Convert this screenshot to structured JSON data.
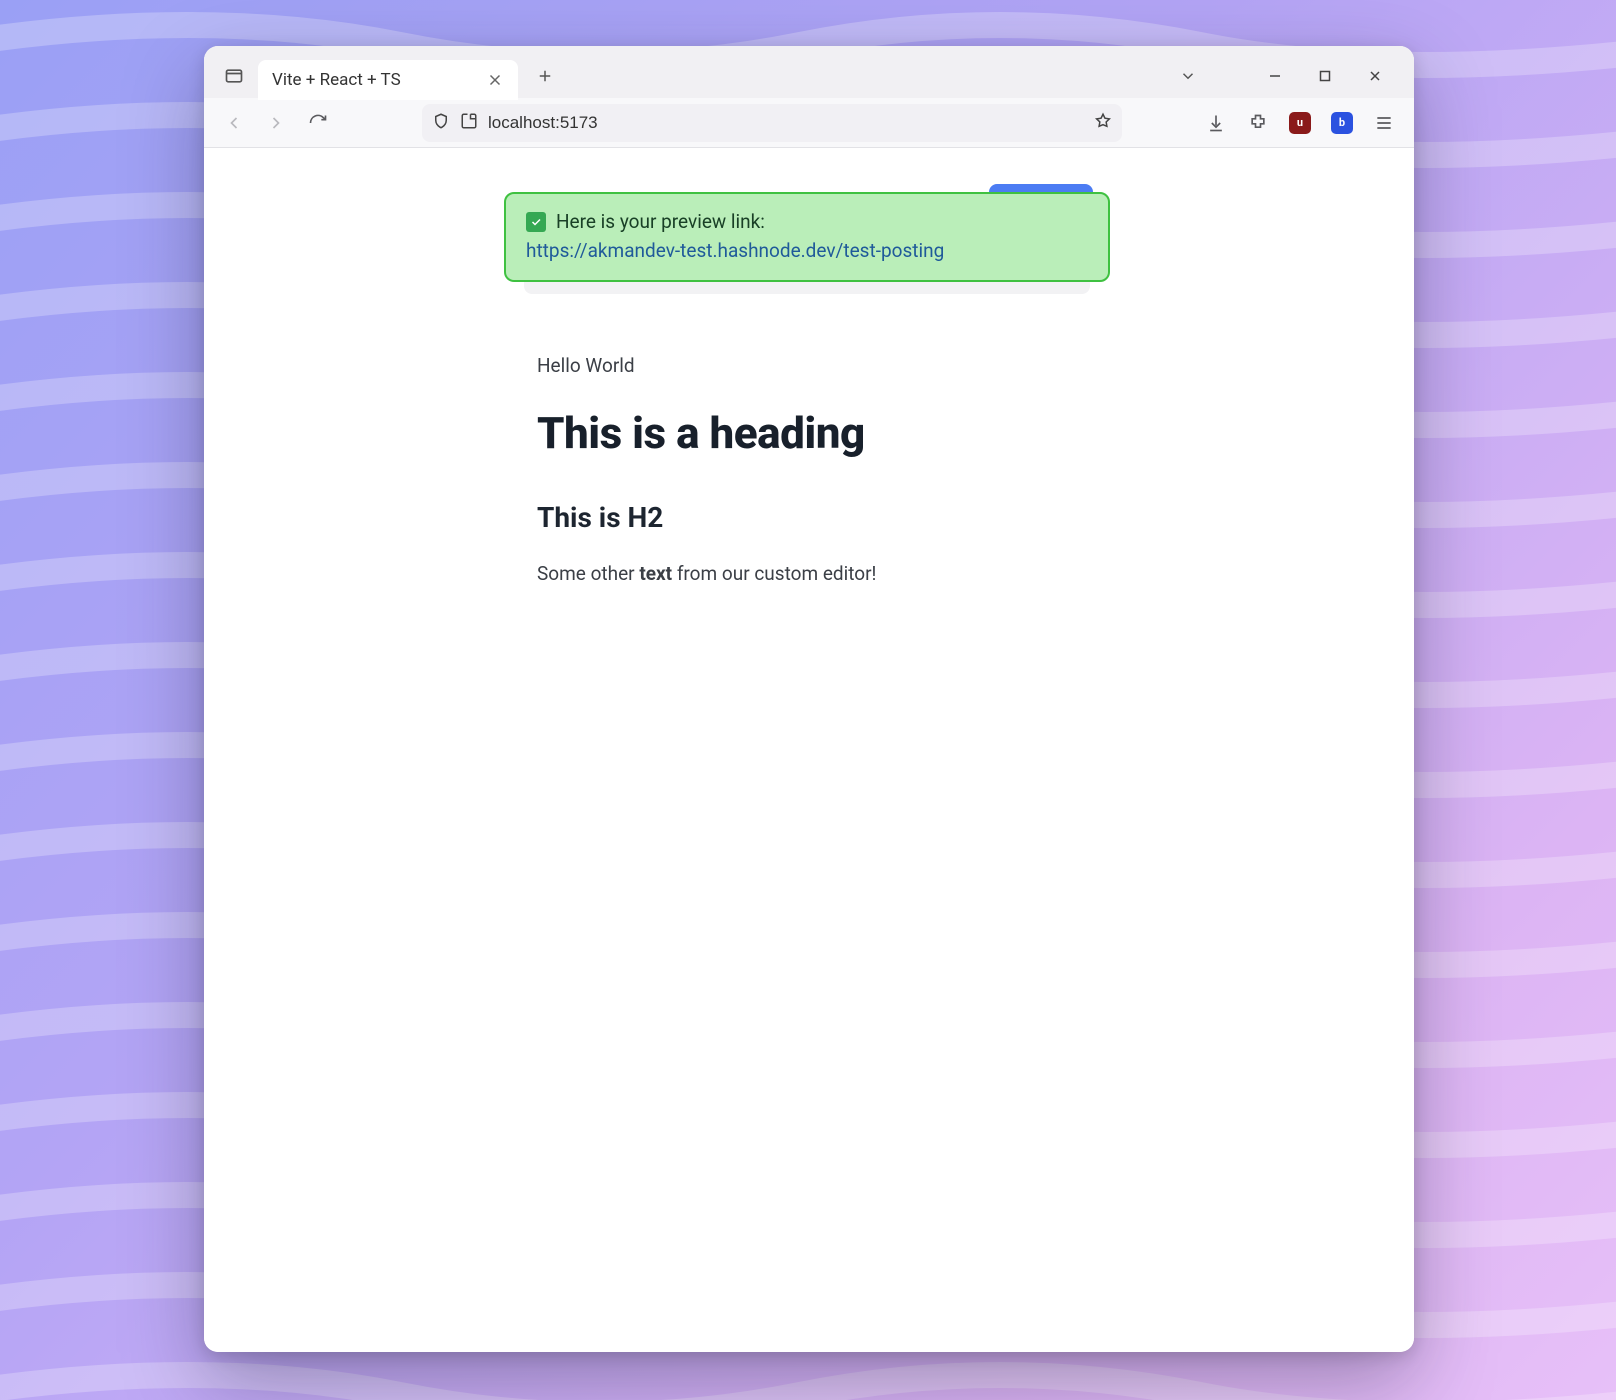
{
  "browser": {
    "tab": {
      "title": "Vite + React + TS"
    },
    "address": "localhost:5173"
  },
  "toast": {
    "message": "Here is your preview link:",
    "link_text": "https://akmandev-test.hashnode.dev/test-posting",
    "link_href": "https://akmandev-test.hashnode.dev/test-posting"
  },
  "article": {
    "hello": "Hello World",
    "h1": "This is a heading",
    "h2": "This is H2",
    "p_pre": "Some other ",
    "p_bold": "text",
    "p_post": " from our custom editor!"
  },
  "colors": {
    "toast_bg": "#baeeb9",
    "toast_border": "#3fc141",
    "link": "#1f5a9a",
    "accent_blue": "#4c7cf3"
  }
}
